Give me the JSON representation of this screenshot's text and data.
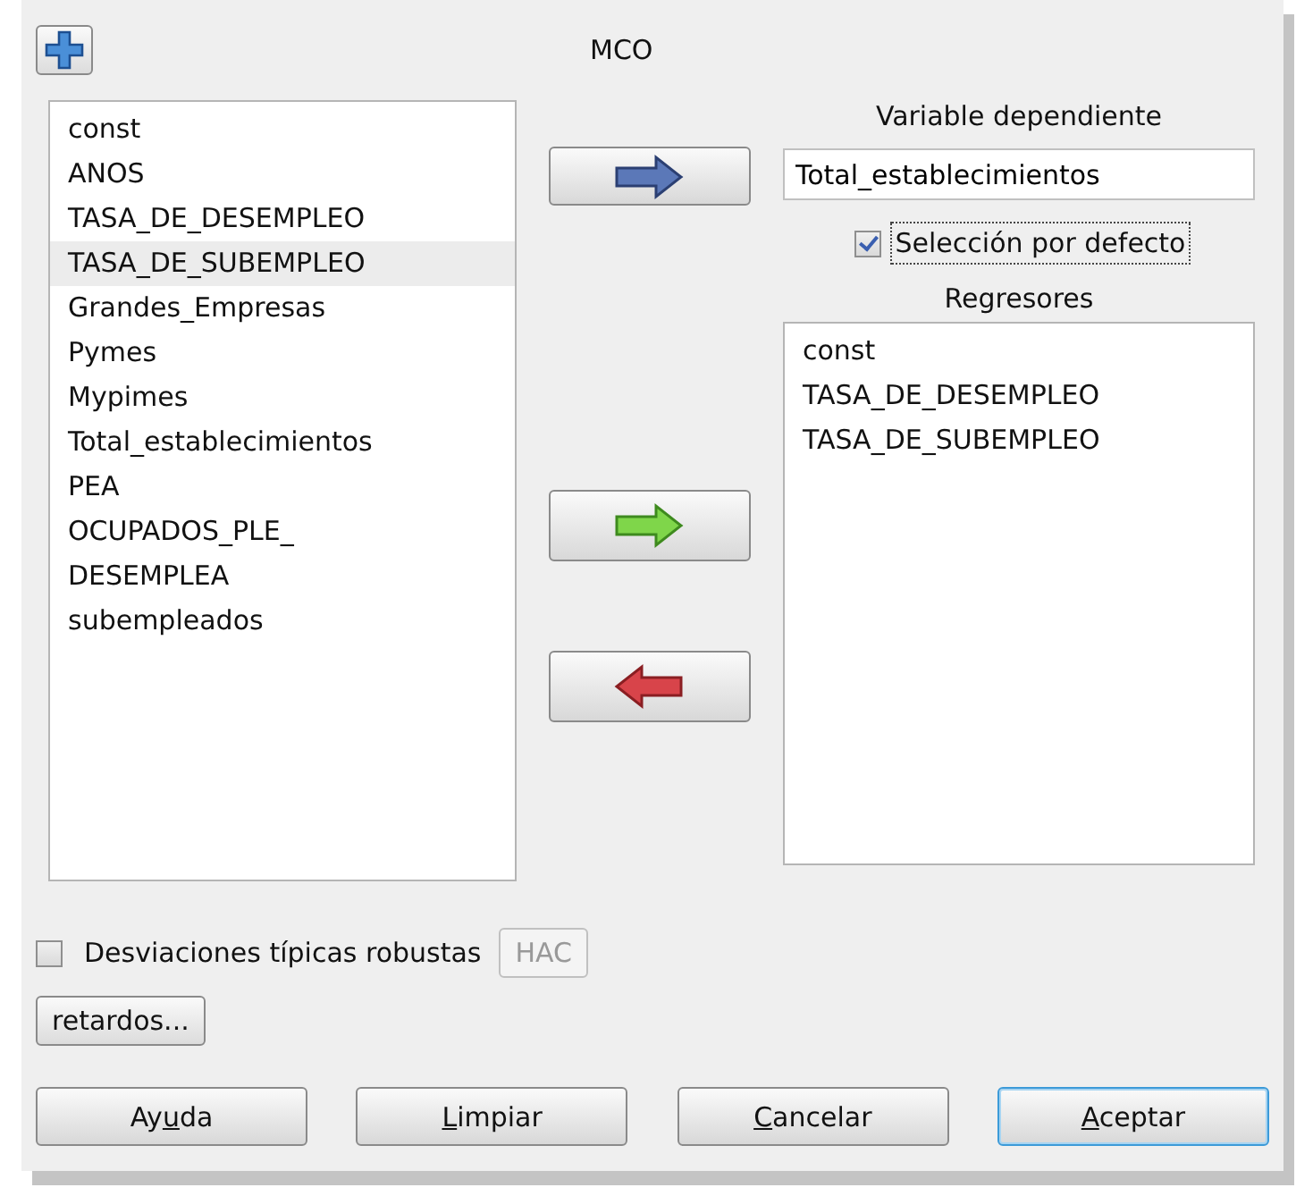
{
  "window": {
    "title": "MCO"
  },
  "variables": [
    {
      "label": "const",
      "selected": false
    },
    {
      "label": "ANOS",
      "selected": false
    },
    {
      "label": "TASA_DE_DESEMPLEO",
      "selected": false
    },
    {
      "label": "TASA_DE_SUBEMPLEO",
      "selected": true
    },
    {
      "label": "Grandes_Empresas",
      "selected": false
    },
    {
      "label": "Pymes",
      "selected": false
    },
    {
      "label": "Mypimes",
      "selected": false
    },
    {
      "label": "Total_establecimientos",
      "selected": false
    },
    {
      "label": "PEA",
      "selected": false
    },
    {
      "label": "OCUPADOS_PLE_",
      "selected": false
    },
    {
      "label": "DESEMPLEA",
      "selected": false
    },
    {
      "label": "subempleados",
      "selected": false
    }
  ],
  "arrow_buttons": [
    {
      "kind": "set"
    },
    {
      "kind": "add"
    },
    {
      "kind": "remove"
    }
  ],
  "dependent": {
    "label": "Variable dependiente",
    "value": "Total_establecimientos"
  },
  "default_selection": {
    "label": "Selección por defecto",
    "checked": true
  },
  "regressors": {
    "label": "Regresores",
    "items": [
      {
        "label": "const",
        "selected": false
      },
      {
        "label": "TASA_DE_DESEMPLEO",
        "selected": false
      },
      {
        "label": "TASA_DE_SUBEMPLEO",
        "selected": false
      }
    ]
  },
  "robust": {
    "label": "Desviaciones típicas robustas",
    "checked": false
  },
  "hac_button": {
    "label": "HAC",
    "disabled": true
  },
  "lags_button": {
    "label": "retardos..."
  },
  "buttons": [
    {
      "before": "Ay",
      "key": "u",
      "after": "da",
      "default": false
    },
    {
      "key": "L",
      "after": "impiar",
      "default": false
    },
    {
      "key": "C",
      "after": "ancelar",
      "default": false
    },
    {
      "key": "A",
      "after": "ceptar",
      "default": true
    }
  ]
}
